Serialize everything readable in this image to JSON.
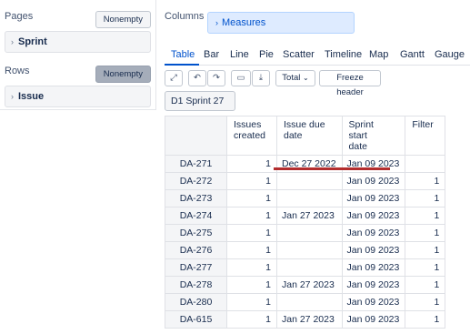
{
  "pages": {
    "label": "Pages",
    "nonempty": "Nonempty",
    "dimension": "Sprint"
  },
  "rows": {
    "label": "Rows",
    "nonempty": "Nonempty",
    "dimension": "Issue"
  },
  "columns": {
    "label": "Columns",
    "dimension": "Measures"
  },
  "tabs": [
    "Table",
    "Bar",
    "Line",
    "Pie",
    "Scatter",
    "Timeline",
    "Map",
    "Gantt",
    "Gauge"
  ],
  "toolbar": {
    "total": "Total",
    "freeze": "Freeze header"
  },
  "page_filter": "D1 Sprint 27",
  "table": {
    "headers": [
      [
        "Issues",
        "created"
      ],
      [
        "Issue due",
        "date"
      ],
      [
        "Sprint",
        "start",
        "date"
      ],
      [
        "Filter"
      ]
    ],
    "rows": [
      {
        "key": "DA-271",
        "issues": "1",
        "due": "Dec 27 2022",
        "start": "Jan 09 2023",
        "filter": ""
      },
      {
        "key": "DA-272",
        "issues": "1",
        "due": "",
        "start": "Jan 09 2023",
        "filter": "1"
      },
      {
        "key": "DA-273",
        "issues": "1",
        "due": "",
        "start": "Jan 09 2023",
        "filter": "1"
      },
      {
        "key": "DA-274",
        "issues": "1",
        "due": "Jan 27 2023",
        "start": "Jan 09 2023",
        "filter": "1"
      },
      {
        "key": "DA-275",
        "issues": "1",
        "due": "",
        "start": "Jan 09 2023",
        "filter": "1"
      },
      {
        "key": "DA-276",
        "issues": "1",
        "due": "",
        "start": "Jan 09 2023",
        "filter": "1"
      },
      {
        "key": "DA-277",
        "issues": "1",
        "due": "",
        "start": "Jan 09 2023",
        "filter": "1"
      },
      {
        "key": "DA-278",
        "issues": "1",
        "due": "Jan 27 2023",
        "start": "Jan 09 2023",
        "filter": "1"
      },
      {
        "key": "DA-280",
        "issues": "1",
        "due": "",
        "start": "Jan 09 2023",
        "filter": "1"
      },
      {
        "key": "DA-615",
        "issues": "1",
        "due": "Jan 27 2023",
        "start": "Jan 09 2023",
        "filter": "1"
      }
    ]
  }
}
